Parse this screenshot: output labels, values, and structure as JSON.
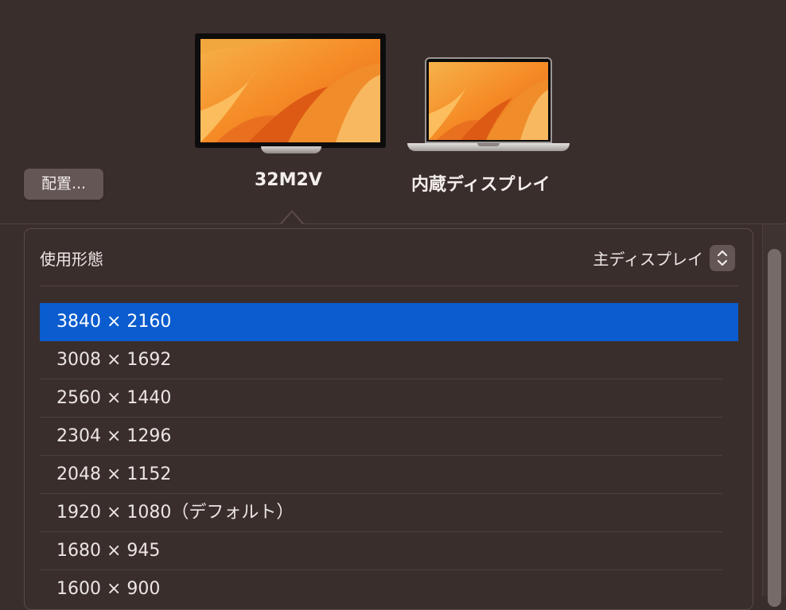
{
  "arrange_button": {
    "label": "配置..."
  },
  "displays": [
    {
      "name": "32M2V",
      "kind": "monitor-icon"
    },
    {
      "name": "内蔵ディスプレイ",
      "kind": "laptop-icon"
    }
  ],
  "settings": {
    "use_as_label": "使用形態",
    "use_as_value": "主ディスプレイ"
  },
  "resolutions": [
    {
      "label": "3840 × 2160",
      "selected": true
    },
    {
      "label": "3008 × 1692",
      "selected": false
    },
    {
      "label": "2560 × 1440",
      "selected": false
    },
    {
      "label": "2304 × 1296",
      "selected": false
    },
    {
      "label": "2048 × 1152",
      "selected": false
    },
    {
      "label": "1920 × 1080（デフォルト）",
      "selected": false
    },
    {
      "label": "1680 × 945",
      "selected": false
    },
    {
      "label": "1600 × 900",
      "selected": false
    }
  ],
  "colors": {
    "background": "#3a2e2c",
    "accent_selected": "#0b5ccf",
    "wallpaper_orange": "#f89a2c"
  }
}
